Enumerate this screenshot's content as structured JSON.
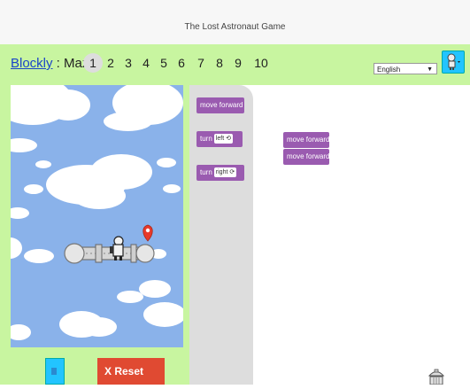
{
  "page": {
    "title": "The Lost Astronaut Game"
  },
  "header": {
    "app_link": "Blockly",
    "separator": " : ",
    "puzzle_name": "Maze",
    "levels": [
      "1",
      "2",
      "3",
      "4",
      "5",
      "6",
      "7",
      "8",
      "9",
      "10"
    ],
    "current_level": "1"
  },
  "language": {
    "selected": "English"
  },
  "controls": {
    "reset_label": "X Reset"
  },
  "toolbox": {
    "move_label": "move forward",
    "turn_label": "turn",
    "turn_left_option": "left ⟲",
    "turn_right_option": "right ⟳"
  },
  "workspace": {
    "blocks": [
      "move forward",
      "move forward"
    ]
  },
  "colors": {
    "top_bar": "#c8f5a0",
    "sky": "#8ab2ea",
    "block": "#9a5bb0",
    "go_button": "#22c4ff",
    "reset_button": "#e04a32",
    "marker": "#e8392a"
  }
}
